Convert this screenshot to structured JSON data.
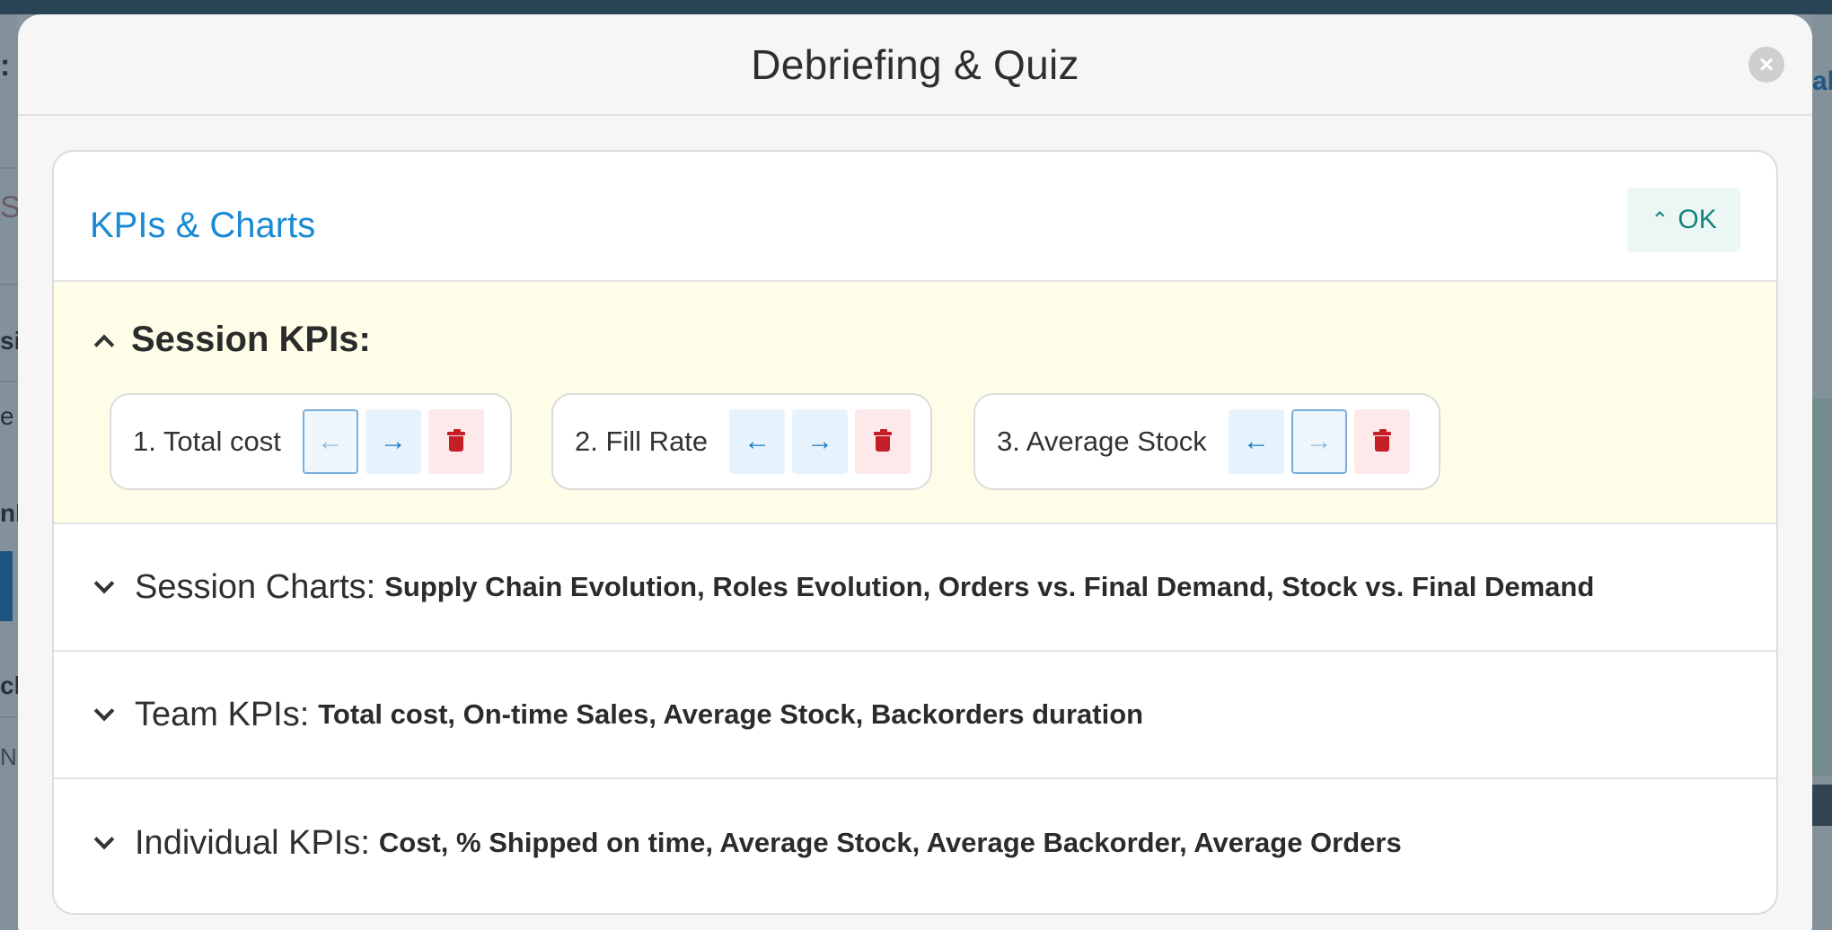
{
  "modal": {
    "title": "Debriefing & Quiz",
    "close_icon": "close-icon"
  },
  "card": {
    "title": "KPIs & Charts",
    "ok_label": "OK"
  },
  "session_kpis": {
    "title": "Session KPIs:",
    "items": [
      {
        "label": "1. Total cost",
        "left_disabled": true,
        "right_disabled": false
      },
      {
        "label": "2. Fill Rate",
        "left_disabled": false,
        "right_disabled": false
      },
      {
        "label": "3. Average Stock",
        "left_disabled": false,
        "right_disabled": true
      }
    ]
  },
  "sections": [
    {
      "label": "Session Charts:",
      "values": "Supply Chain Evolution, Roles Evolution, Orders vs. Final Demand, Stock vs. Final Demand"
    },
    {
      "label": "Team KPIs:",
      "values": "Total cost, On-time Sales, Average Stock, Backorders duration"
    },
    {
      "label": "Individual KPIs:",
      "values": "Cost, % Shipped on time, Average Stock, Average Backorder, Average Orders"
    }
  ],
  "background": {
    "left_fragments": [
      ":",
      "S",
      "si",
      "e",
      "nb",
      "ck",
      "N"
    ],
    "right_fragment": "al"
  },
  "colors": {
    "accent_blue": "#1a8ad4",
    "ok_teal": "#16857a",
    "delete_red": "#c41e27",
    "kpi_section_bg": "#fdfde8"
  }
}
